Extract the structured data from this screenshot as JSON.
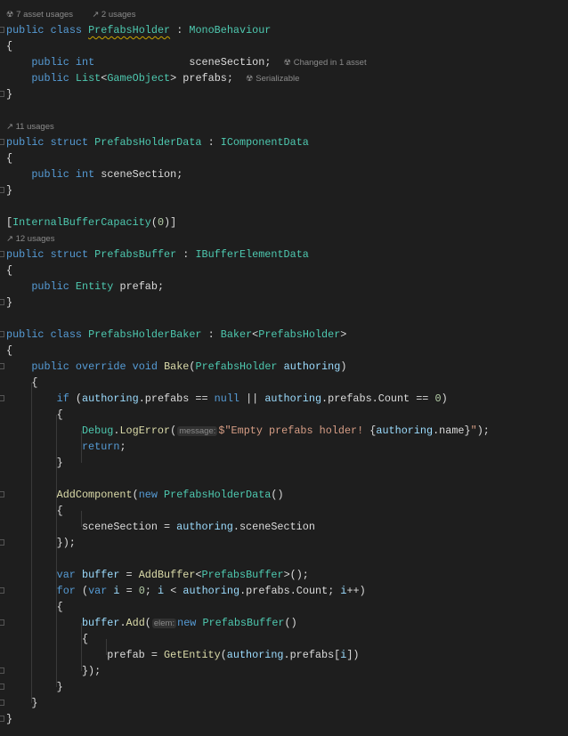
{
  "lines": [
    [
      [
        "☢ 7 asset usages",
        "h"
      ],
      [
        "   ",
        "p"
      ],
      [
        "↗ 2 usages",
        "h"
      ]
    ],
    [
      [
        "public",
        "k"
      ],
      [
        " ",
        "p"
      ],
      [
        "class",
        "k"
      ],
      [
        " ",
        "p"
      ],
      [
        "PrefabsHolder",
        "t squig"
      ],
      [
        " : ",
        "p"
      ],
      [
        "MonoBehaviour",
        "t"
      ]
    ],
    [
      [
        "{",
        "p"
      ]
    ],
    [
      [
        "    ",
        "p"
      ],
      [
        "public",
        "k"
      ],
      [
        " ",
        "p"
      ],
      [
        "int",
        "k"
      ],
      [
        "               ",
        "p"
      ],
      [
        "sceneSection",
        "p"
      ],
      [
        ";  ",
        "p"
      ],
      [
        "☢ Changed in 1 asset",
        "h"
      ]
    ],
    [
      [
        "    ",
        "p"
      ],
      [
        "public",
        "k"
      ],
      [
        " ",
        "p"
      ],
      [
        "List",
        "t"
      ],
      [
        "<",
        "p"
      ],
      [
        "GameObject",
        "t"
      ],
      [
        "> ",
        "p"
      ],
      [
        "prefabs",
        "p"
      ],
      [
        ";  ",
        "p"
      ],
      [
        "☢ Serializable",
        "h"
      ]
    ],
    [
      [
        "}",
        "p"
      ]
    ],
    [],
    [
      [
        "↗ 11 usages",
        "h"
      ]
    ],
    [
      [
        "public",
        "k"
      ],
      [
        " ",
        "p"
      ],
      [
        "struct",
        "k"
      ],
      [
        " ",
        "p"
      ],
      [
        "PrefabsHolderData",
        "t"
      ],
      [
        " : ",
        "p"
      ],
      [
        "IComponentData",
        "t"
      ]
    ],
    [
      [
        "{",
        "p"
      ]
    ],
    [
      [
        "    ",
        "p"
      ],
      [
        "public",
        "k"
      ],
      [
        " ",
        "p"
      ],
      [
        "int",
        "k"
      ],
      [
        " ",
        "p"
      ],
      [
        "sceneSection",
        "p"
      ],
      [
        ";",
        "p"
      ]
    ],
    [
      [
        "}",
        "p"
      ]
    ],
    [],
    [
      [
        "[",
        "p"
      ],
      [
        "InternalBufferCapacity",
        "t"
      ],
      [
        "(",
        "p"
      ],
      [
        "0",
        "n"
      ],
      [
        ")]",
        "p"
      ]
    ],
    [
      [
        "↗ 12 usages",
        "h"
      ]
    ],
    [
      [
        "public",
        "k"
      ],
      [
        " ",
        "p"
      ],
      [
        "struct",
        "k"
      ],
      [
        " ",
        "p"
      ],
      [
        "PrefabsBuffer",
        "t"
      ],
      [
        " : ",
        "p"
      ],
      [
        "IBufferElementData",
        "t"
      ]
    ],
    [
      [
        "{",
        "p"
      ]
    ],
    [
      [
        "    ",
        "p"
      ],
      [
        "public",
        "k"
      ],
      [
        " ",
        "p"
      ],
      [
        "Entity",
        "t"
      ],
      [
        " ",
        "p"
      ],
      [
        "prefab",
        "p"
      ],
      [
        ";",
        "p"
      ]
    ],
    [
      [
        "}",
        "p"
      ]
    ],
    [],
    [
      [
        "public",
        "k"
      ],
      [
        " ",
        "p"
      ],
      [
        "class",
        "k"
      ],
      [
        " ",
        "p"
      ],
      [
        "PrefabsHolderBaker",
        "t"
      ],
      [
        " : ",
        "p"
      ],
      [
        "Baker",
        "t"
      ],
      [
        "<",
        "p"
      ],
      [
        "PrefabsHolder",
        "t"
      ],
      [
        ">",
        "p"
      ]
    ],
    [
      [
        "{",
        "p"
      ]
    ],
    [
      [
        "    ",
        "p"
      ],
      [
        "public",
        "k"
      ],
      [
        " ",
        "p"
      ],
      [
        "override",
        "k"
      ],
      [
        " ",
        "p"
      ],
      [
        "void",
        "k"
      ],
      [
        " ",
        "p"
      ],
      [
        "Bake",
        "m"
      ],
      [
        "(",
        "p"
      ],
      [
        "PrefabsHolder",
        "t"
      ],
      [
        " ",
        "p"
      ],
      [
        "authoring",
        "v"
      ],
      [
        ")",
        "p"
      ]
    ],
    [
      [
        "    {",
        "p"
      ]
    ],
    [
      [
        "        ",
        "p"
      ],
      [
        "if",
        "k"
      ],
      [
        " (",
        "p"
      ],
      [
        "authoring",
        "v"
      ],
      [
        ".prefabs == ",
        "p"
      ],
      [
        "null",
        "k"
      ],
      [
        " || ",
        "p"
      ],
      [
        "authoring",
        "v"
      ],
      [
        ".prefabs.Count == ",
        "p"
      ],
      [
        "0",
        "n"
      ],
      [
        ")",
        "p"
      ]
    ],
    [
      [
        "        {",
        "p"
      ]
    ],
    [
      [
        "            ",
        "p"
      ],
      [
        "Debug",
        "t"
      ],
      [
        ".",
        "p"
      ],
      [
        "LogError",
        "m"
      ],
      [
        "(",
        "p"
      ],
      [
        "message:",
        "ih"
      ],
      [
        "$\"Empty prefabs holder! ",
        "s"
      ],
      [
        "{",
        "p"
      ],
      [
        "authoring",
        "v"
      ],
      [
        ".name",
        "p"
      ],
      [
        "}",
        "p"
      ],
      [
        "\"",
        "s"
      ],
      [
        ");",
        "p"
      ]
    ],
    [
      [
        "            ",
        "p"
      ],
      [
        "return",
        "k"
      ],
      [
        ";",
        "p"
      ]
    ],
    [
      [
        "        }",
        "p"
      ]
    ],
    [],
    [
      [
        "        ",
        "p"
      ],
      [
        "AddComponent",
        "m"
      ],
      [
        "(",
        "p"
      ],
      [
        "new",
        "k"
      ],
      [
        " ",
        "p"
      ],
      [
        "PrefabsHolderData",
        "t"
      ],
      [
        "()",
        "p"
      ]
    ],
    [
      [
        "        {",
        "p"
      ]
    ],
    [
      [
        "            sceneSection = ",
        "p"
      ],
      [
        "authoring",
        "v"
      ],
      [
        ".sceneSection",
        "p"
      ]
    ],
    [
      [
        "        });",
        "p"
      ]
    ],
    [],
    [
      [
        "        ",
        "p"
      ],
      [
        "var",
        "k"
      ],
      [
        " ",
        "p"
      ],
      [
        "buffer",
        "v"
      ],
      [
        " = ",
        "p"
      ],
      [
        "AddBuffer",
        "m"
      ],
      [
        "<",
        "p"
      ],
      [
        "PrefabsBuffer",
        "t"
      ],
      [
        ">();",
        "p"
      ]
    ],
    [
      [
        "        ",
        "p"
      ],
      [
        "for",
        "k"
      ],
      [
        " (",
        "p"
      ],
      [
        "var",
        "k"
      ],
      [
        " ",
        "p"
      ],
      [
        "i",
        "v"
      ],
      [
        " = ",
        "p"
      ],
      [
        "0",
        "n"
      ],
      [
        "; ",
        "p"
      ],
      [
        "i",
        "v"
      ],
      [
        " < ",
        "p"
      ],
      [
        "authoring",
        "v"
      ],
      [
        ".prefabs.Count; ",
        "p"
      ],
      [
        "i",
        "v"
      ],
      [
        "++)",
        "p"
      ]
    ],
    [
      [
        "        {",
        "p"
      ]
    ],
    [
      [
        "            ",
        "p"
      ],
      [
        "buffer",
        "v"
      ],
      [
        ".",
        "p"
      ],
      [
        "Add",
        "m"
      ],
      [
        "(",
        "p"
      ],
      [
        "elem:",
        "ih"
      ],
      [
        "new",
        "k"
      ],
      [
        " ",
        "p"
      ],
      [
        "PrefabsBuffer",
        "t"
      ],
      [
        "()",
        "p"
      ]
    ],
    [
      [
        "            {",
        "p"
      ]
    ],
    [
      [
        "                prefab = ",
        "p"
      ],
      [
        "GetEntity",
        "m"
      ],
      [
        "(",
        "p"
      ],
      [
        "authoring",
        "v"
      ],
      [
        ".prefabs[",
        "p"
      ],
      [
        "i",
        "v"
      ],
      [
        "])",
        "p"
      ]
    ],
    [
      [
        "            });",
        "p"
      ]
    ],
    [
      [
        "        }",
        "p"
      ]
    ],
    [
      [
        "    }",
        "p"
      ]
    ],
    [
      [
        "}",
        "p"
      ]
    ]
  ]
}
